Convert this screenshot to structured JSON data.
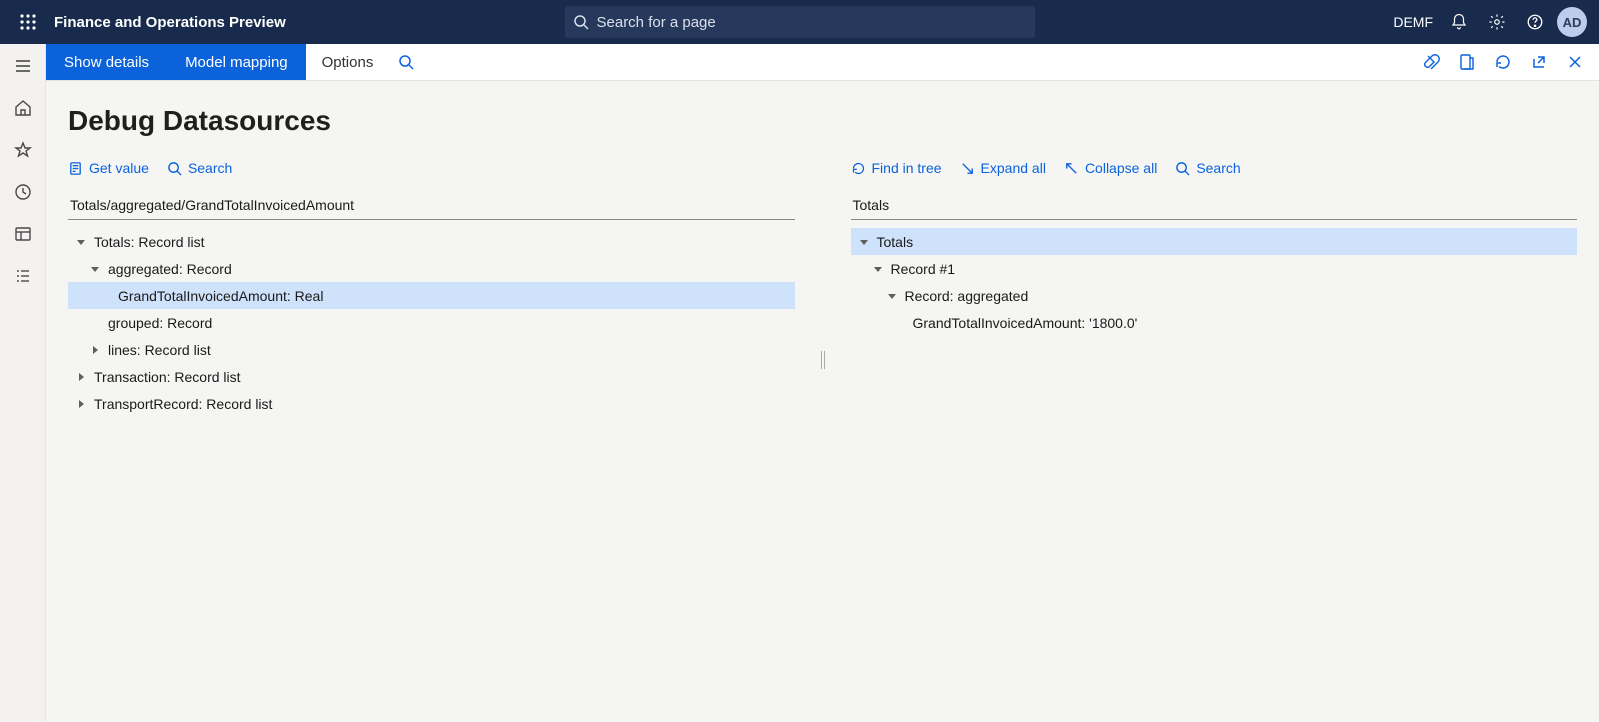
{
  "header": {
    "app_title": "Finance and Operations Preview",
    "search_placeholder": "Search for a page",
    "company": "DEMF",
    "avatar_initials": "AD"
  },
  "action_bar": {
    "show_details": "Show details",
    "model_mapping": "Model mapping",
    "options": "Options"
  },
  "page": {
    "title": "Debug Datasources"
  },
  "left": {
    "tools": {
      "get_value": "Get value",
      "search": "Search"
    },
    "path": "Totals/aggregated/GrandTotalInvoicedAmount",
    "nodes": {
      "n0": "Totals: Record list",
      "n1": "aggregated: Record",
      "n2": "GrandTotalInvoicedAmount: Real",
      "n3": "grouped: Record",
      "n4": "lines: Record list",
      "n5": "Transaction: Record list",
      "n6": "TransportRecord: Record list"
    }
  },
  "right": {
    "tools": {
      "find": "Find in tree",
      "expand": "Expand all",
      "collapse": "Collapse all",
      "search": "Search"
    },
    "path": "Totals",
    "nodes": {
      "r0": "Totals",
      "r1": "Record #1",
      "r2": "Record: aggregated",
      "r3": "GrandTotalInvoicedAmount: '1800.0'"
    }
  }
}
